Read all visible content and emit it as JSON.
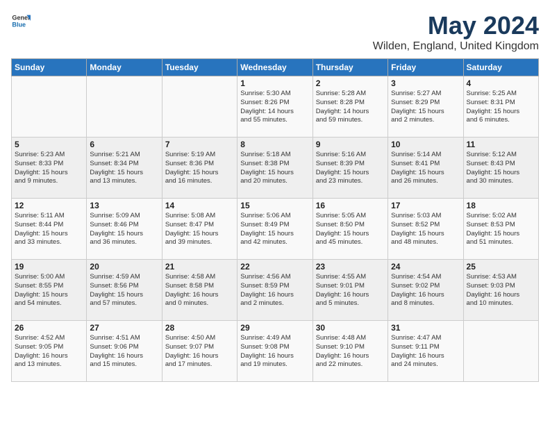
{
  "logo": {
    "general": "General",
    "blue": "Blue"
  },
  "title": "May 2024",
  "subtitle": "Wilden, England, United Kingdom",
  "days": [
    "Sunday",
    "Monday",
    "Tuesday",
    "Wednesday",
    "Thursday",
    "Friday",
    "Saturday"
  ],
  "weeks": [
    [
      {
        "num": "",
        "text": ""
      },
      {
        "num": "",
        "text": ""
      },
      {
        "num": "",
        "text": ""
      },
      {
        "num": "1",
        "text": "Sunrise: 5:30 AM\nSunset: 8:26 PM\nDaylight: 14 hours\nand 55 minutes."
      },
      {
        "num": "2",
        "text": "Sunrise: 5:28 AM\nSunset: 8:28 PM\nDaylight: 14 hours\nand 59 minutes."
      },
      {
        "num": "3",
        "text": "Sunrise: 5:27 AM\nSunset: 8:29 PM\nDaylight: 15 hours\nand 2 minutes."
      },
      {
        "num": "4",
        "text": "Sunrise: 5:25 AM\nSunset: 8:31 PM\nDaylight: 15 hours\nand 6 minutes."
      }
    ],
    [
      {
        "num": "5",
        "text": "Sunrise: 5:23 AM\nSunset: 8:33 PM\nDaylight: 15 hours\nand 9 minutes."
      },
      {
        "num": "6",
        "text": "Sunrise: 5:21 AM\nSunset: 8:34 PM\nDaylight: 15 hours\nand 13 minutes."
      },
      {
        "num": "7",
        "text": "Sunrise: 5:19 AM\nSunset: 8:36 PM\nDaylight: 15 hours\nand 16 minutes."
      },
      {
        "num": "8",
        "text": "Sunrise: 5:18 AM\nSunset: 8:38 PM\nDaylight: 15 hours\nand 20 minutes."
      },
      {
        "num": "9",
        "text": "Sunrise: 5:16 AM\nSunset: 8:39 PM\nDaylight: 15 hours\nand 23 minutes."
      },
      {
        "num": "10",
        "text": "Sunrise: 5:14 AM\nSunset: 8:41 PM\nDaylight: 15 hours\nand 26 minutes."
      },
      {
        "num": "11",
        "text": "Sunrise: 5:12 AM\nSunset: 8:43 PM\nDaylight: 15 hours\nand 30 minutes."
      }
    ],
    [
      {
        "num": "12",
        "text": "Sunrise: 5:11 AM\nSunset: 8:44 PM\nDaylight: 15 hours\nand 33 minutes."
      },
      {
        "num": "13",
        "text": "Sunrise: 5:09 AM\nSunset: 8:46 PM\nDaylight: 15 hours\nand 36 minutes."
      },
      {
        "num": "14",
        "text": "Sunrise: 5:08 AM\nSunset: 8:47 PM\nDaylight: 15 hours\nand 39 minutes."
      },
      {
        "num": "15",
        "text": "Sunrise: 5:06 AM\nSunset: 8:49 PM\nDaylight: 15 hours\nand 42 minutes."
      },
      {
        "num": "16",
        "text": "Sunrise: 5:05 AM\nSunset: 8:50 PM\nDaylight: 15 hours\nand 45 minutes."
      },
      {
        "num": "17",
        "text": "Sunrise: 5:03 AM\nSunset: 8:52 PM\nDaylight: 15 hours\nand 48 minutes."
      },
      {
        "num": "18",
        "text": "Sunrise: 5:02 AM\nSunset: 8:53 PM\nDaylight: 15 hours\nand 51 minutes."
      }
    ],
    [
      {
        "num": "19",
        "text": "Sunrise: 5:00 AM\nSunset: 8:55 PM\nDaylight: 15 hours\nand 54 minutes."
      },
      {
        "num": "20",
        "text": "Sunrise: 4:59 AM\nSunset: 8:56 PM\nDaylight: 15 hours\nand 57 minutes."
      },
      {
        "num": "21",
        "text": "Sunrise: 4:58 AM\nSunset: 8:58 PM\nDaylight: 16 hours\nand 0 minutes."
      },
      {
        "num": "22",
        "text": "Sunrise: 4:56 AM\nSunset: 8:59 PM\nDaylight: 16 hours\nand 2 minutes."
      },
      {
        "num": "23",
        "text": "Sunrise: 4:55 AM\nSunset: 9:01 PM\nDaylight: 16 hours\nand 5 minutes."
      },
      {
        "num": "24",
        "text": "Sunrise: 4:54 AM\nSunset: 9:02 PM\nDaylight: 16 hours\nand 8 minutes."
      },
      {
        "num": "25",
        "text": "Sunrise: 4:53 AM\nSunset: 9:03 PM\nDaylight: 16 hours\nand 10 minutes."
      }
    ],
    [
      {
        "num": "26",
        "text": "Sunrise: 4:52 AM\nSunset: 9:05 PM\nDaylight: 16 hours\nand 13 minutes."
      },
      {
        "num": "27",
        "text": "Sunrise: 4:51 AM\nSunset: 9:06 PM\nDaylight: 16 hours\nand 15 minutes."
      },
      {
        "num": "28",
        "text": "Sunrise: 4:50 AM\nSunset: 9:07 PM\nDaylight: 16 hours\nand 17 minutes."
      },
      {
        "num": "29",
        "text": "Sunrise: 4:49 AM\nSunset: 9:08 PM\nDaylight: 16 hours\nand 19 minutes."
      },
      {
        "num": "30",
        "text": "Sunrise: 4:48 AM\nSunset: 9:10 PM\nDaylight: 16 hours\nand 22 minutes."
      },
      {
        "num": "31",
        "text": "Sunrise: 4:47 AM\nSunset: 9:11 PM\nDaylight: 16 hours\nand 24 minutes."
      },
      {
        "num": "",
        "text": ""
      }
    ]
  ]
}
